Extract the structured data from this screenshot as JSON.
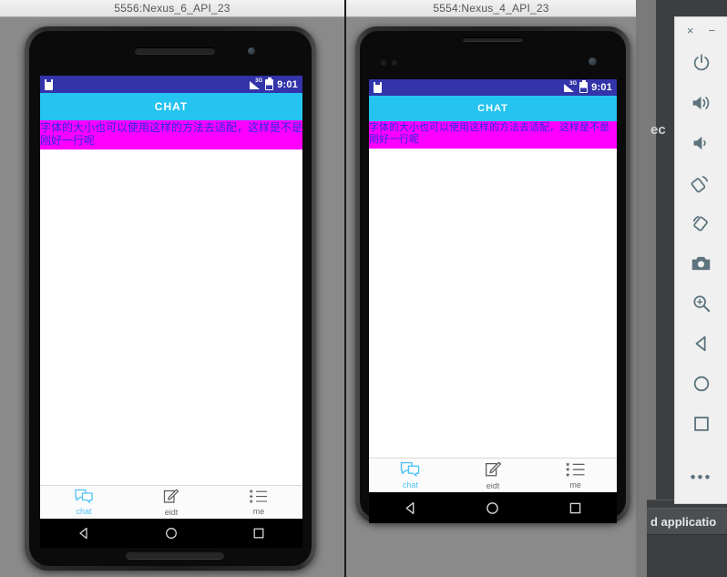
{
  "emulators": [
    {
      "id": "emu-nexus6",
      "title": "5556:Nexus_6_API_23",
      "status_bar": {
        "time": "9:01",
        "network": "3G",
        "sim_icon": "sim-card-icon",
        "signal_icon": "signal-bars-icon",
        "battery_icon": "battery-icon"
      },
      "app": {
        "title": "CHAT",
        "message": "字体的大小也可以使用这样的方法去适配，这样是不是刚好一行呢",
        "nav": [
          {
            "label": "chat",
            "icon": "chat-bubbles-icon",
            "active": true
          },
          {
            "label": "eidt",
            "icon": "edit-pencil-icon",
            "active": false
          },
          {
            "label": "me",
            "icon": "starred-list-icon",
            "active": false
          }
        ]
      },
      "system_keys": [
        {
          "name": "back-key",
          "glyph": "triangle-left"
        },
        {
          "name": "home-key",
          "glyph": "circle"
        },
        {
          "name": "recents-key",
          "glyph": "square"
        }
      ]
    },
    {
      "id": "emu-nexus4",
      "title": "5554:Nexus_4_API_23",
      "status_bar": {
        "time": "9:01",
        "network": "3G",
        "sim_icon": "sim-card-icon",
        "signal_icon": "signal-bars-icon",
        "battery_icon": "battery-icon"
      },
      "app": {
        "title": "CHAT",
        "message": "字体的大小也可以使用这样的方法去适配，这样是不是刚好一行呢",
        "nav": [
          {
            "label": "chat",
            "icon": "chat-bubbles-icon",
            "active": true
          },
          {
            "label": "eidt",
            "icon": "edit-pencil-icon",
            "active": false
          },
          {
            "label": "me",
            "icon": "starred-list-icon",
            "active": false
          }
        ]
      },
      "system_keys": [
        {
          "name": "back-key",
          "glyph": "triangle-left"
        },
        {
          "name": "home-key",
          "glyph": "circle"
        },
        {
          "name": "recents-key",
          "glyph": "square"
        }
      ]
    }
  ],
  "toolbar": {
    "close_label": "×",
    "minimize_label": "−",
    "buttons": [
      {
        "name": "power-button",
        "icon": "power-icon"
      },
      {
        "name": "volume-up-button",
        "icon": "volume-up-icon"
      },
      {
        "name": "volume-down-button",
        "icon": "volume-down-icon"
      },
      {
        "name": "rotate-left-button",
        "icon": "rotate-left-icon"
      },
      {
        "name": "rotate-right-button",
        "icon": "rotate-right-icon"
      },
      {
        "name": "screenshot-button",
        "icon": "camera-icon"
      },
      {
        "name": "zoom-button",
        "icon": "magnifier-plus-icon"
      },
      {
        "name": "back-button",
        "icon": "triangle-left-icon"
      },
      {
        "name": "home-button",
        "icon": "circle-icon"
      },
      {
        "name": "overview-button",
        "icon": "square-icon"
      }
    ],
    "more_label": "•••"
  },
  "background": {
    "clipped_text_right": "ec",
    "clipped_text_bottom": "d applicatio"
  },
  "colors": {
    "status_bar": "#3333aa",
    "title_bar": "#25c3f0",
    "message_bar": "#ff00ff",
    "message_text": "#2b2be0",
    "accent": "#4fc3f7",
    "toolbar_icon": "#5d737e"
  }
}
